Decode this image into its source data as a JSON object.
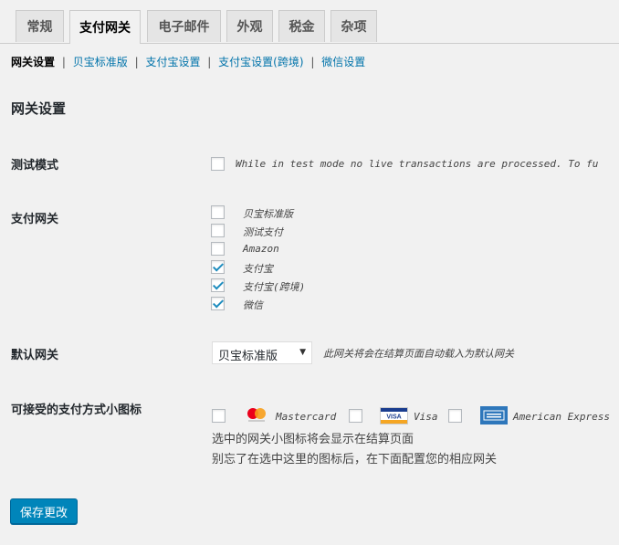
{
  "tabs": [
    "常规",
    "支付网关",
    "电子邮件",
    "外观",
    "税金",
    "杂项"
  ],
  "subnav": {
    "current": "网关设置",
    "links": [
      "贝宝标准版",
      "支付宝设置",
      "支付宝设置(跨境)",
      "微信设置"
    ],
    "separator": "|"
  },
  "section_title": "网关设置",
  "test_mode": {
    "label": "测试模式",
    "checked": false,
    "description": "While in test mode no live transactions are processed. To fu"
  },
  "gateways": {
    "label": "支付网关",
    "items": [
      {
        "label": "贝宝标准版",
        "checked": false
      },
      {
        "label": "测试支付",
        "checked": false
      },
      {
        "label": "Amazon",
        "checked": false
      },
      {
        "label": "支付宝",
        "checked": true
      },
      {
        "label": "支付宝(跨境)",
        "checked": true
      },
      {
        "label": "微信",
        "checked": true
      }
    ]
  },
  "default_gateway": {
    "label": "默认网关",
    "selected": "贝宝标准版",
    "description": "此网关将会在结算页面自动载入为默认网关"
  },
  "icons": {
    "label": "可接受的支付方式小图标",
    "cards": [
      {
        "name": "Mastercard",
        "icon": "mastercard-icon",
        "checked": false
      },
      {
        "name": "Visa",
        "icon": "visa-icon",
        "checked": false
      },
      {
        "name": "American Express",
        "icon": "amex-icon",
        "checked": false
      }
    ],
    "help_line1": "选中的网关小图标将会显示在结算页面",
    "help_line2": "别忘了在选中这里的图标后，在下面配置您的相应网关"
  },
  "save_label": "保存更改",
  "colors": {
    "link": "#0073aa",
    "button": "#0085ba",
    "check": "#1e8cbe"
  }
}
